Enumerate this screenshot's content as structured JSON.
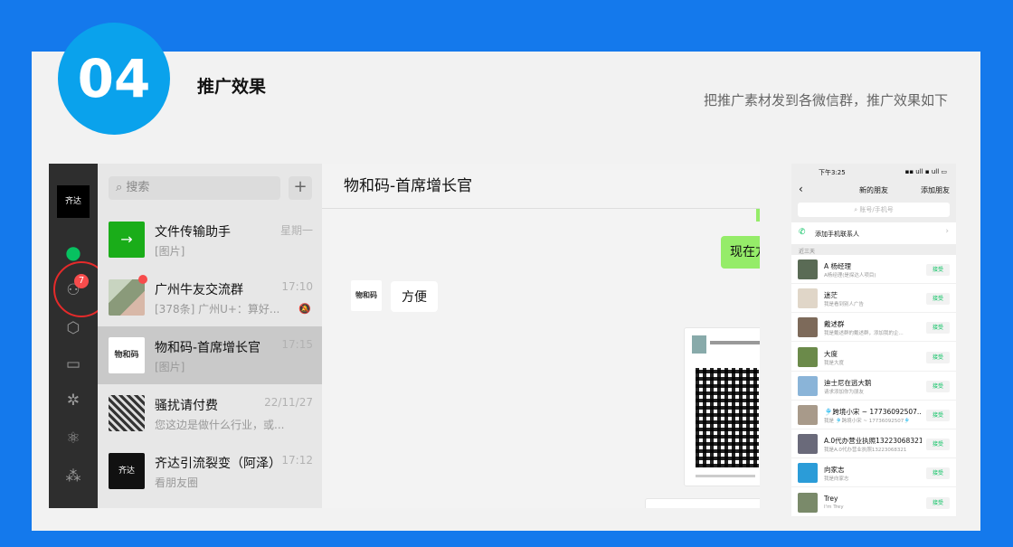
{
  "slide": {
    "badge": "04",
    "title": "推广效果",
    "subtitle": "把推广素材发到各微信群，推广效果如下"
  },
  "wechat": {
    "nav_logo_text": "齐达",
    "contacts_badge": "7",
    "search_placeholder": "搜索",
    "add_symbol": "+",
    "chats": [
      {
        "name": "文件传输助手",
        "preview": "[图片]",
        "time": "星期一",
        "avatar_color": "#1aad19",
        "avatar_text": "→"
      },
      {
        "name": "广州牛友交流群",
        "preview": "[378条] 广州U+：算好...",
        "time": "17:10",
        "avatar_color": "#7a8a7a",
        "avatar_text": ""
      },
      {
        "name": "物和码-首席增长官",
        "preview": "[图片]",
        "time": "17:15",
        "avatar_color": "#ffffff",
        "avatar_text": "物和码"
      },
      {
        "name": "骚扰请付费",
        "preview": "您这边是做什么行业，或...",
        "time": "22/11/27",
        "avatar_color": "#555555",
        "avatar_text": ""
      },
      {
        "name": "齐达引流裂变（阿泽）",
        "preview": "看朋友圈",
        "time": "17:12",
        "avatar_color": "#111111",
        "avatar_text": "齐达"
      }
    ],
    "main_title": "物和码-首席增长官",
    "green_message": "现在方",
    "incoming_avatar": "物和码",
    "incoming_message": "方便"
  },
  "phone": {
    "time": "下午3:25",
    "signal": "▪▪ ull ▪ ull ▭",
    "back": "‹",
    "title": "新的朋友",
    "add": "添加朋友",
    "search_placeholder": "账号/手机号",
    "add_contacts": "添加手机联系人",
    "section": "近三天",
    "accept_label": "接受",
    "friends": [
      {
        "name": "A 杨经理",
        "sub": "A杨经理(是探达人项目)",
        "color": "#5a6b55"
      },
      {
        "name": "迷茫",
        "sub": "我是看到别人广告",
        "color": "#e0d6c8"
      },
      {
        "name": "戴述群",
        "sub": "我是戴述群的戴述群，添加我的企...",
        "color": "#7d6a5a"
      },
      {
        "name": "大度",
        "sub": "我是大度",
        "color": "#6b8a4a"
      },
      {
        "name": "迪士尼在逃大鹅",
        "sub": "请求添加你为朋友",
        "color": "#8ab4d8"
      },
      {
        "name": "🎐跨境小宋 ~ 17736092507...",
        "sub": "我是 🎐跨境小宋 ~ 17736092507🎐",
        "color": "#a89a8a"
      },
      {
        "name": "A.0代办营业执照13223068321",
        "sub": "我是A.0代办营业执照13223068321",
        "color": "#6a6a7a"
      },
      {
        "name": "向家志",
        "sub": "我是向家志",
        "color": "#2b9cd8"
      },
      {
        "name": "Trey",
        "sub": "I'm Trey",
        "color": "#7a8a6a"
      }
    ]
  }
}
